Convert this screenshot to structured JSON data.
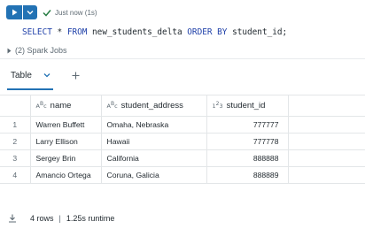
{
  "toolbar": {
    "status_text": "Just now (1s)"
  },
  "code": {
    "kw_select": "SELECT",
    "star": " * ",
    "kw_from": "FROM",
    "table": " new_students_delta ",
    "kw_order_by": "ORDER BY",
    "tail": " student_id;"
  },
  "spark_jobs": {
    "label": "(2) Spark Jobs"
  },
  "tabs": {
    "table_label": "Table"
  },
  "grid": {
    "columns": [
      {
        "type_icon": "ABC",
        "label": "name"
      },
      {
        "type_icon": "ABC",
        "label": "student_address"
      },
      {
        "type_icon": "123",
        "label": "student_id"
      }
    ],
    "rows": [
      {
        "n": "1",
        "name": "Warren Buffett",
        "address": "Omaha, Nebraska",
        "id": "777777"
      },
      {
        "n": "2",
        "name": "Larry Ellison",
        "address": "Hawaii",
        "id": "777778"
      },
      {
        "n": "3",
        "name": "Sergey Brin",
        "address": "California",
        "id": "888888"
      },
      {
        "n": "4",
        "name": "Amancio Ortega",
        "address": "Coruna, Galicia",
        "id": "888889"
      }
    ]
  },
  "footer": {
    "rows_text": "4 rows",
    "separator": "|",
    "runtime_text": "1.25s runtime"
  },
  "colors": {
    "accent": "#2272b4",
    "success": "#277c43",
    "keyword": "#1e3fa8"
  },
  "icons": [
    "play-icon",
    "chevron-down-icon",
    "check-icon",
    "caret-right-icon",
    "plus-icon",
    "download-icon"
  ]
}
